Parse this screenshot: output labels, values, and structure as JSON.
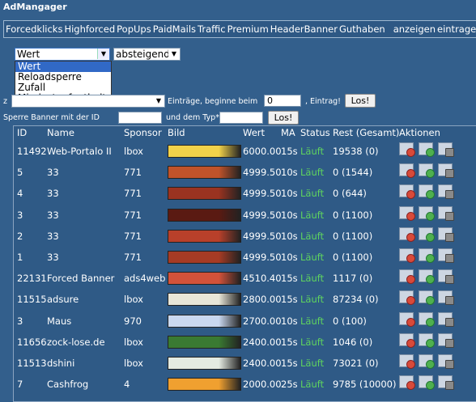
{
  "app": {
    "title": "AdMangager"
  },
  "nav": {
    "items": [
      "Forcedklicks",
      "Highforced",
      "PopUps",
      "PaidMails",
      "Traffic",
      "Premium",
      "HeaderBanner",
      "Guthaben",
      "anzeigen",
      "eintrage"
    ]
  },
  "sort": {
    "field_selected": "Wert",
    "direction_selected": "absteigend",
    "options": [
      "Wert",
      "Reloadsperre",
      "Zufall",
      "Mindestaufenthalt"
    ]
  },
  "filter": {
    "entries_label": "Einträge, beginne beim",
    "start_value": "0",
    "entry_label": ", Eintrag!",
    "go_label": "Los!",
    "block_label": "Sperre Banner mit der ID",
    "type_label": "und dem Typ*",
    "go2_label": "Los!",
    "prefix": "z"
  },
  "partial_heading": "I",
  "table": {
    "headers": [
      "ID",
      "Name",
      "Sponsor",
      "Bild",
      "Wert",
      "MA",
      "Status",
      "Rest (Gesamt)",
      "Aktionen"
    ],
    "rows": [
      {
        "id": "11492",
        "name": "Web-Portalo II",
        "sponsor": "lbox",
        "wert": "6000.00",
        "ma": "15s",
        "status": "Läuft",
        "rest": "19538 (0)",
        "banner": "#f2d24a"
      },
      {
        "id": "5",
        "name": "33",
        "sponsor": "771",
        "wert": "4999.50",
        "ma": "10s",
        "status": "Läuft",
        "rest": "0 (1544)",
        "banner": "#c0532a"
      },
      {
        "id": "4",
        "name": "33",
        "sponsor": "771",
        "wert": "4999.50",
        "ma": "10s",
        "status": "Läuft",
        "rest": "0 (644)",
        "banner": "#9a3320"
      },
      {
        "id": "3",
        "name": "33",
        "sponsor": "771",
        "wert": "4999.50",
        "ma": "10s",
        "status": "Läuft",
        "rest": "0 (1100)",
        "banner": "#5a1a12"
      },
      {
        "id": "2",
        "name": "33",
        "sponsor": "771",
        "wert": "4999.50",
        "ma": "10s",
        "status": "Läuft",
        "rest": "0 (1100)",
        "banner": "#b8402a"
      },
      {
        "id": "1",
        "name": "33",
        "sponsor": "771",
        "wert": "4999.50",
        "ma": "10s",
        "status": "Läuft",
        "rest": "0 (1100)",
        "banner": "#a63b24"
      },
      {
        "id": "22131",
        "name": "Forced Banner",
        "sponsor": "ads4web",
        "wert": "4510.40",
        "ma": "15s",
        "status": "Läuft",
        "rest": "1117 (0)",
        "banner": "#d2523a"
      },
      {
        "id": "11515",
        "name": "adsure",
        "sponsor": "lbox",
        "wert": "2800.00",
        "ma": "15s",
        "status": "Läuft",
        "rest": "87234 (0)",
        "banner": "#e8e6d8"
      },
      {
        "id": "3",
        "name": "Maus",
        "sponsor": "970",
        "wert": "2700.00",
        "ma": "10s",
        "status": "Läuft",
        "rest": "0 (100)",
        "banner": "#c9d8f0"
      },
      {
        "id": "11656",
        "name": "zock-lose.de",
        "sponsor": "lbox",
        "wert": "2400.00",
        "ma": "15s",
        "status": "Läuft",
        "rest": "1046 (0)",
        "banner": "#3a7a32"
      },
      {
        "id": "11513",
        "name": "dshini",
        "sponsor": "lbox",
        "wert": "2400.00",
        "ma": "15s",
        "status": "Läuft",
        "rest": "73021 (0)",
        "banner": "#e4ebe2"
      },
      {
        "id": "7",
        "name": "Cashfrog",
        "sponsor": "4",
        "wert": "2000.00",
        "ma": "25s",
        "status": "Läuft",
        "rest": "9785 (10000)",
        "banner": "#f0a030"
      }
    ]
  },
  "colors": {
    "background": "#335f8c",
    "status": "#5fd35f"
  }
}
